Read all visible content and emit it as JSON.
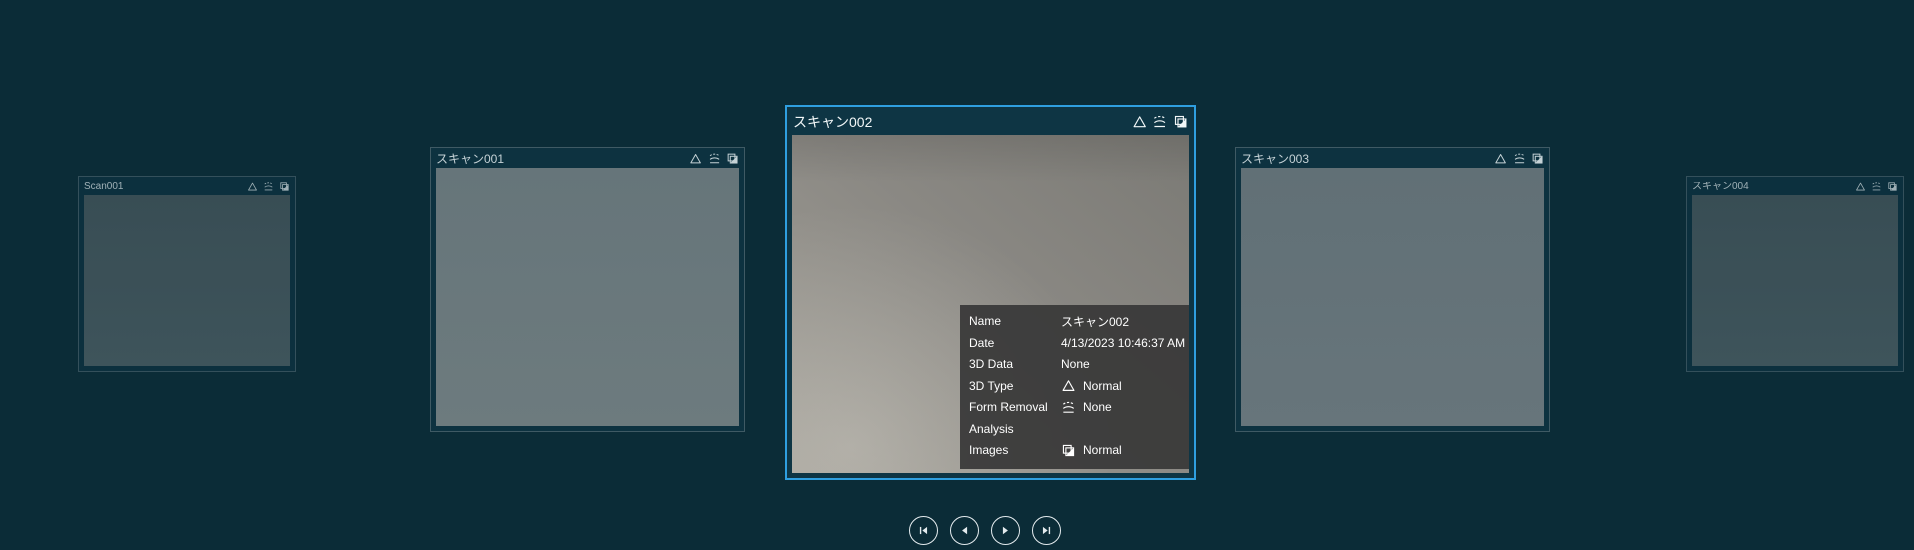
{
  "colors": {
    "background": "#0b2c37",
    "selection_border": "#2f9fe0",
    "info_panel_bg": "#383838",
    "text": "#ffffff"
  },
  "carousel": {
    "selected_index": 2,
    "status_icons": [
      "3d-type-triangle",
      "form-removal",
      "images"
    ],
    "cards": [
      {
        "title": "Scan001"
      },
      {
        "title": "スキャン001"
      },
      {
        "title": "スキャン002"
      },
      {
        "title": "スキャン003"
      },
      {
        "title": "スキャン004"
      }
    ]
  },
  "info_panel": {
    "rows": [
      {
        "label": "Name",
        "value": "スキャン002"
      },
      {
        "label": "Date",
        "value": "4/13/2023 10:46:37 AM"
      },
      {
        "label": "3D Data",
        "value": "None"
      },
      {
        "label": "3D Type",
        "value": "Normal",
        "icon": "triangle"
      },
      {
        "label": "Form Removal",
        "value": "None",
        "icon": "form-removal"
      },
      {
        "label": "Analysis",
        "value": ""
      },
      {
        "label": "Images",
        "value": "Normal",
        "icon": "images"
      }
    ]
  },
  "nav": {
    "buttons": [
      {
        "icon": "skip-first"
      },
      {
        "icon": "previous"
      },
      {
        "icon": "next"
      },
      {
        "icon": "skip-last"
      }
    ]
  }
}
